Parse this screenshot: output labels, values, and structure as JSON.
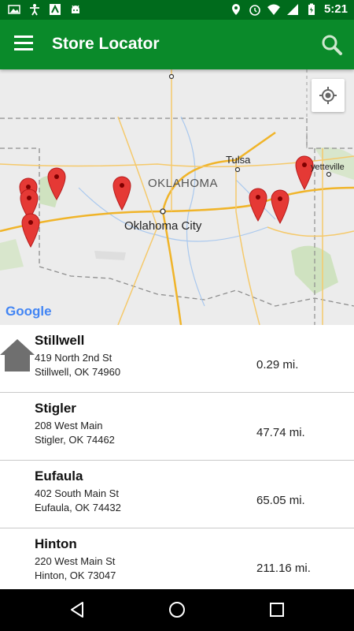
{
  "status_bar": {
    "time": "5:21",
    "left_icons": [
      "image-icon",
      "accessibility-icon",
      "ditto-icon",
      "android-icon"
    ],
    "right_icons": [
      "location-icon",
      "alarm-icon",
      "wifi-icon",
      "signal-icon",
      "battery-icon"
    ]
  },
  "appbar": {
    "title": "Store Locator",
    "menu_icon": "hamburger-menu-icon",
    "search_icon": "search-icon"
  },
  "map": {
    "labels": {
      "state": "OKLAHOMA",
      "city_main": "Oklahoma City",
      "city_tulsa": "Tulsa",
      "city_fayetteville": "yetteville"
    },
    "logo": "Google",
    "marker_color": "#e53935",
    "locate_icon": "my-location-icon"
  },
  "stores": [
    {
      "name": "Stillwell",
      "address_line1": "419 North 2nd St",
      "address_line2": "Stillwell, OK 74960",
      "distance": "0.29 mi.",
      "home": true
    },
    {
      "name": "Stigler",
      "address_line1": "208 West Main",
      "address_line2": "Stigler, OK 74462",
      "distance": "47.74 mi.",
      "home": false
    },
    {
      "name": "Eufaula",
      "address_line1": "402 South Main St",
      "address_line2": "Eufaula, OK 74432",
      "distance": "65.05 mi.",
      "home": false
    },
    {
      "name": "Hinton",
      "address_line1": "220 West Main St",
      "address_line2": "Hinton, OK 73047",
      "distance": "211.16 mi.",
      "home": false
    }
  ],
  "colors": {
    "status_bar": "#006b1c",
    "app_bar": "#0a8a2a",
    "nav_bar": "#000000"
  },
  "nav_bar": [
    "back-icon",
    "home-circle-icon",
    "recents-icon"
  ]
}
